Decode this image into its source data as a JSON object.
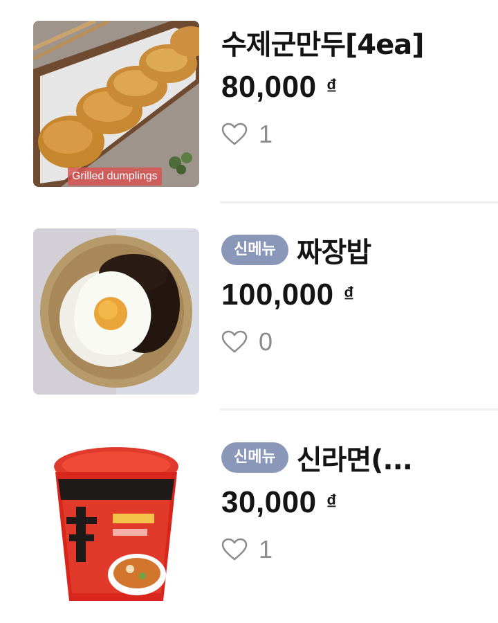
{
  "menu": {
    "items": [
      {
        "title": "수제군만두[4ea]",
        "badge": "",
        "price": "80,000",
        "currency": "₫",
        "likes": "1",
        "thumb_caption": "Grilled dumplings",
        "heart_icon": "heart-outline-icon"
      },
      {
        "title": "짜장밥",
        "badge": "신메뉴",
        "price": "100,000",
        "currency": "₫",
        "likes": "0",
        "heart_icon": "heart-outline-icon"
      },
      {
        "title": "신라면(...",
        "badge": "신메뉴",
        "price": "30,000",
        "currency": "₫",
        "likes": "1",
        "heart_icon": "heart-outline-icon"
      }
    ]
  },
  "colors": {
    "badge_bg": "#8a97b8",
    "caption_bg": "#d65454",
    "divider": "#f0f0f2",
    "like_count": "#8a8a8a"
  }
}
